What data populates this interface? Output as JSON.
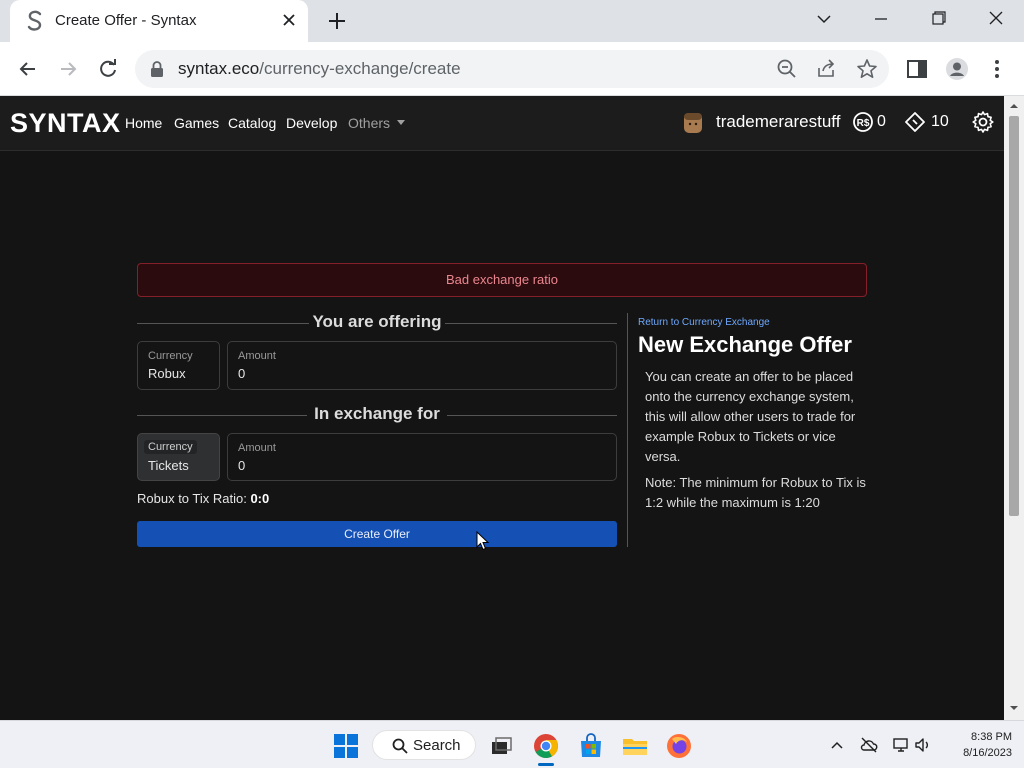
{
  "browser": {
    "tab_title": "Create Offer - Syntax",
    "url_host": "syntax.eco",
    "url_path": "/currency-exchange/create"
  },
  "navbar": {
    "brand": "SYNTAX",
    "links": [
      "Home",
      "Games",
      "Catalog",
      "Develop"
    ],
    "others_label": "Others",
    "username": "trademerarestuff",
    "robux": "0",
    "tickets": "10"
  },
  "alert": {
    "message": "Bad exchange ratio"
  },
  "offering": {
    "heading": "You are offering",
    "currency_label": "Currency",
    "currency_value": "Robux",
    "amount_label": "Amount",
    "amount_value": "0"
  },
  "exchange": {
    "heading": "In exchange for",
    "currency_label": "Currency",
    "currency_value": "Tickets",
    "amount_label": "Amount",
    "amount_value": "0"
  },
  "ratio": {
    "label": "Robux to Tix Ratio:",
    "value": "0:0"
  },
  "create_button": "Create Offer",
  "sidebar": {
    "return_link": "Return to Currency Exchange",
    "title": "New Exchange Offer",
    "description": "You can create an offer to be placed onto the currency exchange system, this will allow other users to trade for example Robux to Tickets or vice versa.",
    "note": "Note: The minimum for Robux to Tix is 1:2 while the maximum is 1:20"
  },
  "taskbar": {
    "search_label": "Search",
    "time": "8:38 PM",
    "date": "8/16/2023"
  },
  "colors": {
    "page_bg": "#141414",
    "navbar_bg": "#1c1c1c",
    "alert_bg": "#2c0b0e",
    "alert_text": "#ea868f",
    "primary_button": "#1550b5",
    "link": "#6ea8fe"
  }
}
